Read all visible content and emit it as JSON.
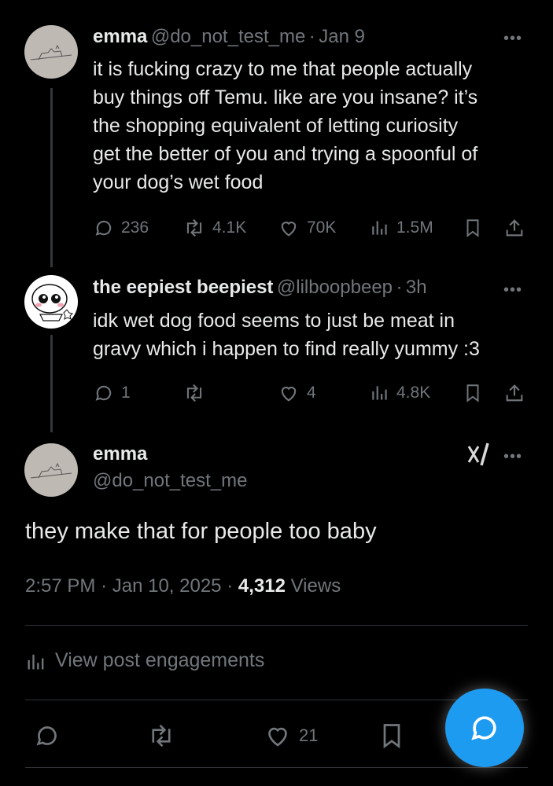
{
  "thread": [
    {
      "author_name": "emma",
      "author_handle": "@do_not_test_me",
      "sep": "·",
      "time": "Jan 9",
      "text_lines": [
        "it is fucking crazy to me that people actually",
        "buy things off Temu. like are you insane? it’s",
        "the shopping equivalent of letting curiosity",
        "get the better of you and trying a spoonful of",
        "your dog’s wet food"
      ],
      "replies": "236",
      "reposts": "4.1K",
      "likes": "70K",
      "views": "1.5M"
    },
    {
      "author_name": "the eepiest beepiest",
      "author_handle": "@lilboopbeep",
      "sep": "·",
      "time": "3h",
      "text_lines": [
        "idk wet dog food seems to just be meat in",
        "gravy which i happen to find really yummy :3"
      ],
      "replies": "1",
      "reposts": "",
      "likes": "4",
      "views": "4.8K"
    }
  ],
  "main_post": {
    "author_name": "emma",
    "author_handle": "@do_not_test_me",
    "text": "they make that for people too baby",
    "time": "2:57 PM",
    "date": "Jan 10, 2025",
    "dot": "·",
    "views_count": "4,312",
    "views_label": "Views",
    "engagements_label": "View post engagements",
    "likes": "21"
  },
  "more_label": "•••",
  "colors": {
    "background": "#000000",
    "text_primary": "#e7e9ea",
    "text_secondary": "#71767b",
    "accent": "#1d9bf0",
    "divider": "#2f3336"
  },
  "icons": [
    "reply-icon",
    "repost-icon",
    "like-icon",
    "views-icon",
    "bookmark-icon",
    "share-icon",
    "grok-icon",
    "compose-reply-icon"
  ]
}
